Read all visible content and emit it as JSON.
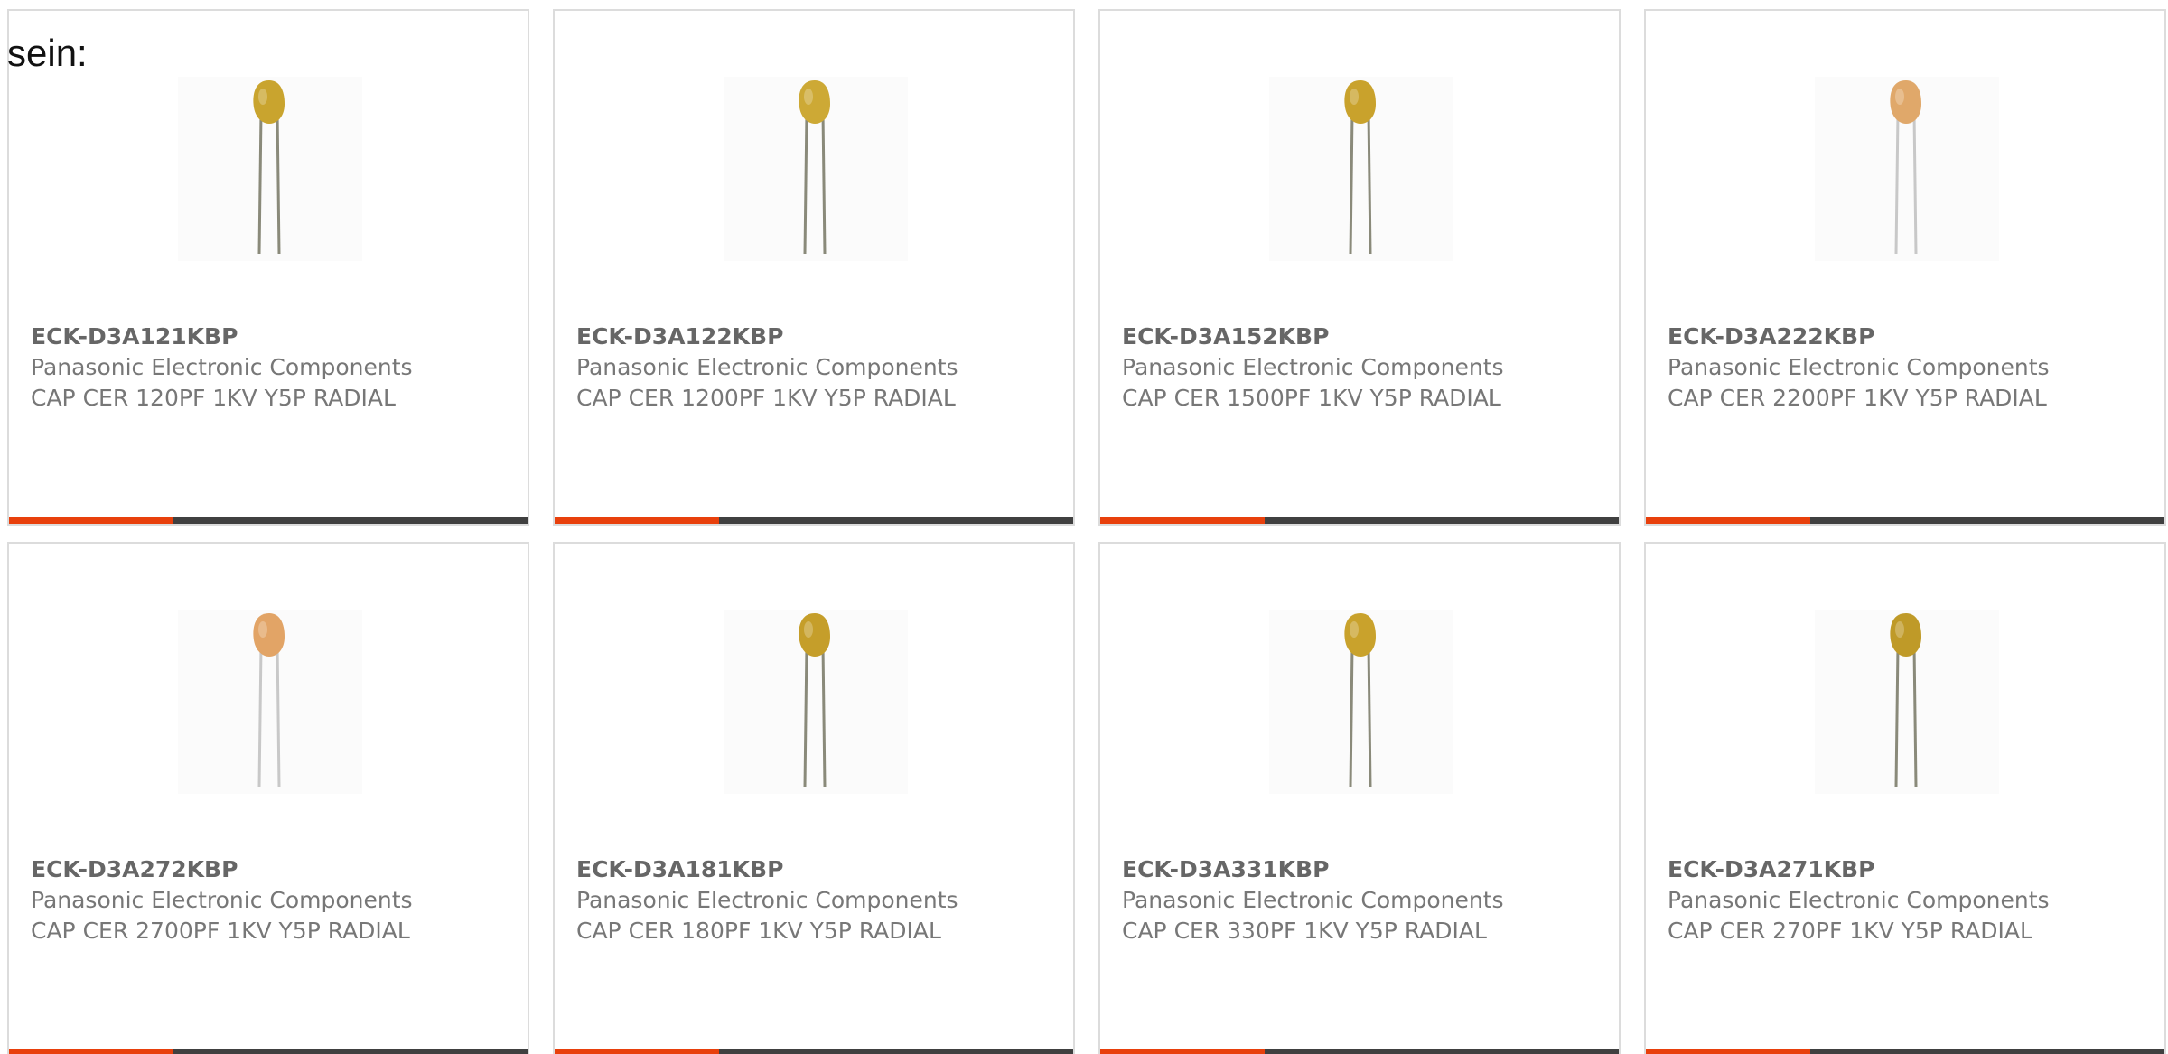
{
  "lead_text": "sein:",
  "colors": {
    "accent_bar": "#e8400c",
    "base_bar": "#404040",
    "card_border": "#dcdcdc",
    "text": "#777777"
  },
  "products": [
    {
      "part_number": "ECK-D3A121KBP",
      "manufacturer": "Panasonic Electronic Components",
      "description": "CAP CER 120PF 1KV Y5P RADIAL",
      "image": "ceramic-disc-capacitor-icon",
      "body_color": "#c9a42e",
      "lead_color": "#8a8a7a"
    },
    {
      "part_number": "ECK-D3A122KBP",
      "manufacturer": "Panasonic Electronic Components",
      "description": "CAP CER 1200PF 1KV Y5P RADIAL",
      "image": "ceramic-disc-capacitor-icon",
      "body_color": "#cda935",
      "lead_color": "#8a8a7a"
    },
    {
      "part_number": "ECK-D3A152KBP",
      "manufacturer": "Panasonic Electronic Components",
      "description": "CAP CER 1500PF 1KV Y5P RADIAL",
      "image": "ceramic-disc-capacitor-icon",
      "body_color": "#c9a22c",
      "lead_color": "#8a8a7a"
    },
    {
      "part_number": "ECK-D3A222KBP",
      "manufacturer": "Panasonic Electronic Components",
      "description": "CAP CER 2200PF 1KV Y5P RADIAL",
      "image": "ceramic-disc-capacitor-icon",
      "body_color": "#e0a86a",
      "lead_color": "#c8c8c8"
    },
    {
      "part_number": "ECK-D3A272KBP",
      "manufacturer": "Panasonic Electronic Components",
      "description": "CAP CER 2700PF 1KV Y5P RADIAL",
      "image": "ceramic-disc-capacitor-icon",
      "body_color": "#e2a466",
      "lead_color": "#c8c8c8"
    },
    {
      "part_number": "ECK-D3A181KBP",
      "manufacturer": "Panasonic Electronic Components",
      "description": "CAP CER 180PF 1KV Y5P RADIAL",
      "image": "ceramic-disc-capacitor-icon",
      "body_color": "#c59e2a",
      "lead_color": "#8a8a7a"
    },
    {
      "part_number": "ECK-D3A331KBP",
      "manufacturer": "Panasonic Electronic Components",
      "description": "CAP CER 330PF 1KV Y5P RADIAL",
      "image": "ceramic-disc-capacitor-icon",
      "body_color": "#c9a22c",
      "lead_color": "#8a8a7a"
    },
    {
      "part_number": "ECK-D3A271KBP",
      "manufacturer": "Panasonic Electronic Components",
      "description": "CAP CER 270PF 1KV Y5P RADIAL",
      "image": "ceramic-disc-capacitor-icon",
      "body_color": "#bf9a28",
      "lead_color": "#8a8a7a"
    }
  ]
}
